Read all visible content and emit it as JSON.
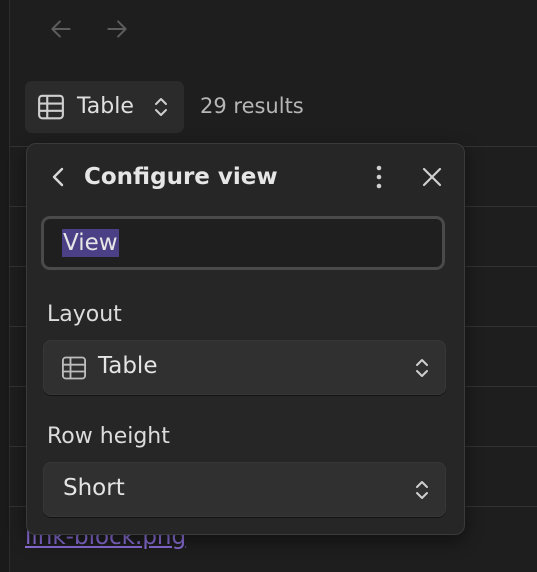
{
  "nav": {
    "back_icon": "arrow-left-icon",
    "forward_icon": "arrow-right-icon"
  },
  "toolbar": {
    "view_icon": "table-icon",
    "view_label": "Table",
    "results_count": "29 results"
  },
  "configure_panel": {
    "title": "Configure view",
    "name_value": "View",
    "layout": {
      "label": "Layout",
      "selected": "Table",
      "icon": "table-icon"
    },
    "row_height": {
      "label": "Row height",
      "selected": "Short"
    }
  },
  "background_row": {
    "link_text": "link-block.png"
  },
  "colors": {
    "background": "#1e1e1e",
    "panel": "#262626",
    "selection": "#4b3f86",
    "link": "#8b6fdb"
  }
}
